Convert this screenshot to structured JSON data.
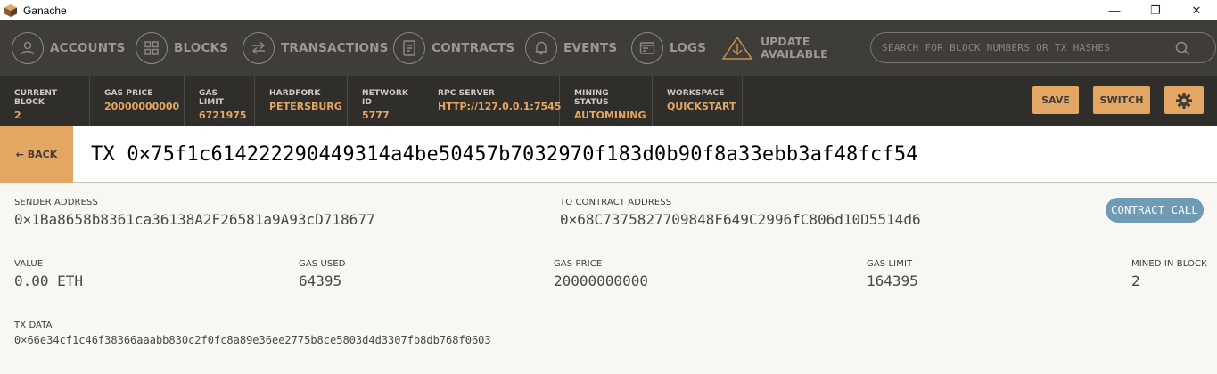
{
  "window": {
    "title": "Ganache",
    "minimize": "—",
    "maximize": "❐",
    "close": "✕"
  },
  "nav": {
    "items": [
      {
        "label": "ACCOUNTS"
      },
      {
        "label": "BLOCKS"
      },
      {
        "label": "TRANSACTIONS"
      },
      {
        "label": "CONTRACTS"
      },
      {
        "label": "EVENTS"
      },
      {
        "label": "LOGS"
      }
    ],
    "update": {
      "line1": "UPDATE",
      "line2": "AVAILABLE"
    },
    "search_placeholder": "SEARCH FOR BLOCK NUMBERS OR TX HASHES"
  },
  "status": {
    "current_block": {
      "label": "CURRENT BLOCK",
      "value": "2"
    },
    "gas_price": {
      "label": "GAS PRICE",
      "value": "20000000000"
    },
    "gas_limit": {
      "label": "GAS LIMIT",
      "value": "6721975"
    },
    "hardfork": {
      "label": "HARDFORK",
      "value": "PETERSBURG"
    },
    "network_id": {
      "label": "NETWORK ID",
      "value": "5777"
    },
    "rpc_server": {
      "label": "RPC SERVER",
      "value": "HTTP://127.0.0.1:7545"
    },
    "mining_status": {
      "label": "MINING STATUS",
      "value": "AUTOMINING"
    },
    "workspace": {
      "label": "WORKSPACE",
      "value": "QUICKSTART"
    },
    "save_label": "SAVE",
    "switch_label": "SWITCH"
  },
  "tx": {
    "back_label": "← BACK",
    "title": "TX 0×75f1c614222290449314a4be50457b7032970f183d0b90f8a33ebb3af48fcf54",
    "badge": "CONTRACT CALL",
    "sender": {
      "label": "SENDER ADDRESS",
      "value": "0×1Ba8658b8361ca36138A2F26581a9A93cD718677"
    },
    "to_contract": {
      "label": "TO CONTRACT ADDRESS",
      "value": "0×68C7375827709848F649C2996fC806d10D5514d6"
    },
    "value": {
      "label": "VALUE",
      "value": "0.00 ETH"
    },
    "gas_used": {
      "label": "GAS USED",
      "value": "64395"
    },
    "gas_price": {
      "label": "GAS PRICE",
      "value": "20000000000"
    },
    "gas_limit": {
      "label": "GAS LIMIT",
      "value": "164395"
    },
    "mined_in_block": {
      "label": "MINED IN BLOCK",
      "value": "2"
    },
    "tx_data": {
      "label": "TX DATA",
      "value": "0×66e34cf1c46f38366aaabb830c2f0fc8a89e36ee2775b8ce5803d4d3307fb8db768f0603"
    }
  },
  "colors": {
    "accent": "#e4a663",
    "nav_bg": "#3f3d39",
    "status_bg": "#302e2a",
    "badge": "#6f9bb4"
  }
}
